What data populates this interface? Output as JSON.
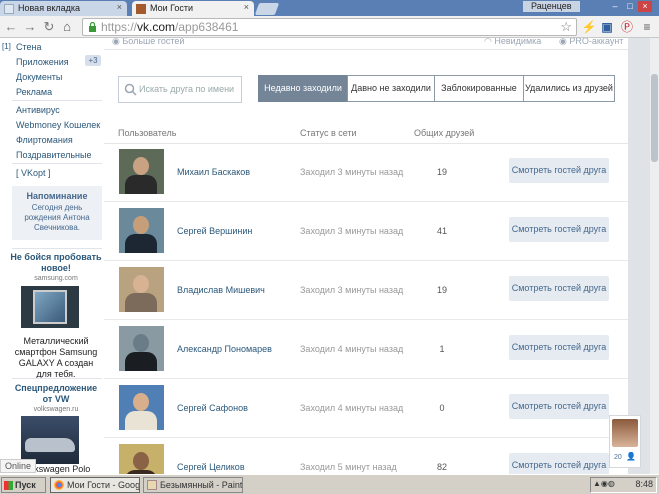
{
  "browser": {
    "tabs": [
      {
        "label": "Новая вкладка",
        "active": false
      },
      {
        "label": "Мои Гости",
        "active": true
      }
    ],
    "user_badge": "Раценцев",
    "url_scheme": "https://",
    "url_host": "vk.com",
    "url_path": "/app638461"
  },
  "sidebar": {
    "marker": "[1]",
    "menu": [
      {
        "label": "Стена"
      },
      {
        "label": "Приложения",
        "badge": "+3"
      },
      {
        "label": "Документы"
      },
      {
        "label": "Реклама"
      }
    ],
    "apps": [
      {
        "label": "Антивирус"
      },
      {
        "label": "Webmoney Кошелек"
      },
      {
        "label": "Флиртомания"
      },
      {
        "label": "Поздравительные"
      }
    ],
    "vkopt": "[ VKopt ]",
    "reminder": {
      "title": "Напоминание",
      "text": "Сегодня день рождения Антона Свечникова."
    },
    "ads": [
      {
        "title": "Не бойся пробовать новое!",
        "domain": "samsung.com",
        "text": "Металлический смартфон Samsung GALAXY A создан для тебя."
      },
      {
        "title": "Спецпредложение от VW",
        "domain": "volkswagen.ru",
        "text": "Volkswagen Polo"
      }
    ]
  },
  "main": {
    "topband": {
      "left": "Больше гостей",
      "invisible": "Невидимка",
      "pro": "PRO-аккаунт"
    },
    "search_placeholder": "Искать друга по имени",
    "filter_tabs": [
      {
        "label": "Недавно заходили",
        "active": true
      },
      {
        "label": "Давно не заходили",
        "active": false
      },
      {
        "label": "Заблокированные",
        "active": false
      },
      {
        "label": "Удалились из друзей",
        "active": false
      }
    ],
    "columns": {
      "user": "Пользователь",
      "status": "Статус в сети",
      "common": "Общих друзей"
    },
    "rows": [
      {
        "name": "Михаил Баскаков",
        "status": "Заходил 3 минуты назад",
        "common": "19",
        "action": "Смотреть гостей друга"
      },
      {
        "name": "Сергей Вершинин",
        "status": "Заходил 3 минуты назад",
        "common": "41",
        "action": "Смотреть гостей друга"
      },
      {
        "name": "Владислав Мишевич",
        "status": "Заходил 3 минуты назад",
        "common": "19",
        "action": "Смотреть гостей друга"
      },
      {
        "name": "Александр Пономарев",
        "status": "Заходил 4 минуты назад",
        "common": "1",
        "action": "Смотреть гостей друга"
      },
      {
        "name": "Сергей Сафонов",
        "status": "Заходил 4 минуты назад",
        "common": "0",
        "action": "Смотреть гостей друга"
      },
      {
        "name": "Сергей Целиков",
        "status": "Заходил 5 минут назад",
        "common": "82",
        "action": "Смотреть гостей друга"
      }
    ]
  },
  "chat_widget": {
    "count": "20"
  },
  "status_hover": "Online",
  "taskbar": {
    "start": "Пуск",
    "tasks": [
      {
        "label": "Мои Гости - Google C...",
        "active": true
      },
      {
        "label": "Безымянный - Paint",
        "active": false
      }
    ],
    "clock": "8:48"
  },
  "colors": {
    "accent": "#2b587a",
    "active_tab": "#738597",
    "button_bg": "#e5ebf1"
  }
}
